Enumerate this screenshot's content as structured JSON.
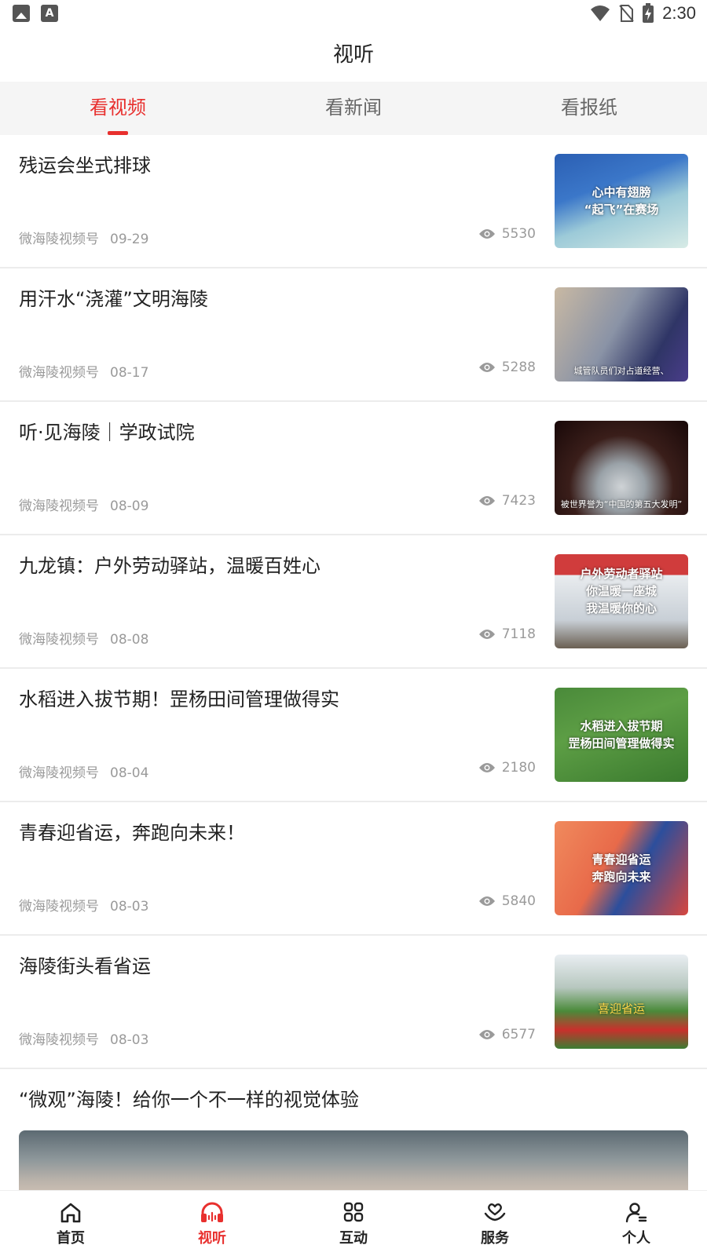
{
  "status_bar": {
    "time": "2:30",
    "left_icons": [
      "image-icon",
      "font-icon"
    ],
    "right_icons": [
      "wifi-icon",
      "no-sim-icon",
      "battery-charging-icon"
    ]
  },
  "header": {
    "title": "视听"
  },
  "tabs": [
    {
      "label": "看视频",
      "active": true
    },
    {
      "label": "看新闻",
      "active": false
    },
    {
      "label": "看报纸",
      "active": false
    }
  ],
  "items": [
    {
      "title": "残运会坐式排球",
      "source": "微海陵视频号",
      "date": "09-29",
      "views": "5530",
      "thumb_caption": "心中有翅膀\n“起飞”在赛场"
    },
    {
      "title": "用汗水“浇灌”文明海陵",
      "source": "微海陵视频号",
      "date": "08-17",
      "views": "5288",
      "thumb_caption": "城管队员们对占道经营、\n机动车乱停放等现象进行整治"
    },
    {
      "title": "听·见海陵｜学政试院",
      "source": "微海陵视频号",
      "date": "08-09",
      "views": "7423",
      "thumb_caption": "被世界誉为“中国的第五大发明”"
    },
    {
      "title": "九龙镇：户外劳动驿站，温暖百姓心",
      "source": "微海陵视频号",
      "date": "08-08",
      "views": "7118",
      "thumb_caption": "户外劳动者驿站\n你温暖一座城\n我温暖你的心"
    },
    {
      "title": "水稻进入拔节期！罡杨田间管理做得实",
      "source": "微海陵视频号",
      "date": "08-04",
      "views": "2180",
      "thumb_caption": "水稻进入拔节期\n罡杨田间管理做得实"
    },
    {
      "title": "青春迎省运，奔跑向未来！",
      "source": "微海陵视频号",
      "date": "08-03",
      "views": "5840",
      "thumb_caption": "青春迎省运\n奔跑向未来"
    },
    {
      "title": "海陵街头看省运",
      "source": "微海陵视频号",
      "date": "08-03",
      "views": "6577",
      "thumb_caption": "喜迎省运"
    }
  ],
  "featured": {
    "title": "“微观”海陵！给你一个不一样的视觉体验"
  },
  "bottom_nav": [
    {
      "label": "首页",
      "icon": "home-icon",
      "active": false
    },
    {
      "label": "视听",
      "icon": "headphones-icon",
      "active": true
    },
    {
      "label": "互动",
      "icon": "grid-icon",
      "active": false
    },
    {
      "label": "服务",
      "icon": "heart-hand-icon",
      "active": false
    },
    {
      "label": "个人",
      "icon": "user-icon",
      "active": false
    }
  ],
  "colors": {
    "accent": "#e8302e",
    "meta_text": "#9a9a9a",
    "tab_bg": "#f5f5f5"
  }
}
